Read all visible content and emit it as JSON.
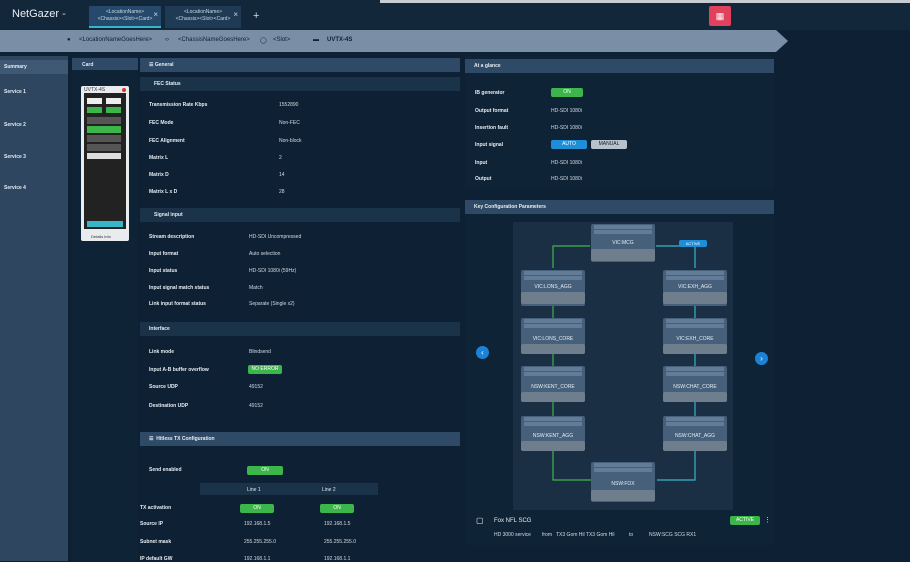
{
  "app": {
    "brand": "NetGazer",
    "brand_suffix": "-"
  },
  "tabs": [
    {
      "line1": "<LocationName>",
      "line2": "<Chassis><Slot><Card>"
    },
    {
      "line1": "<LocationName>",
      "line2": "<Chassis><Slot><Card>"
    }
  ],
  "breadcrumb": {
    "location": "<LocationNameGoesHere>",
    "chassis": "<ChassisNameGoesHere>",
    "slot": "<Slot>",
    "card": "UVTX-4S"
  },
  "sidebar": {
    "items": [
      {
        "label": "Summary"
      },
      {
        "label": "Service 1"
      },
      {
        "label": "Service 2"
      },
      {
        "label": "Service 3"
      },
      {
        "label": "Service 4"
      }
    ]
  },
  "card_panel": {
    "title": "Card",
    "device": {
      "name": "UVTX-4S",
      "footer": "Details info"
    }
  },
  "general": {
    "title": "General",
    "fec": {
      "title": "FEC Status",
      "rows": [
        {
          "k": "Transmission Rate Kbps",
          "v": "1552890"
        },
        {
          "k": "FEC Mode",
          "v": "Non-FEC"
        },
        {
          "k": "FEC Alignment",
          "v": "Non-block"
        },
        {
          "k": "Matrix L",
          "v": "2"
        },
        {
          "k": "Matrix D",
          "v": "14"
        },
        {
          "k": "Matrix L x D",
          "v": "28"
        }
      ]
    },
    "signal": {
      "title": "Signal input",
      "rows": [
        {
          "k": "Stream description",
          "v": "HD-SDI Uncompressed"
        },
        {
          "k": "Input format",
          "v": "Auto selection"
        },
        {
          "k": "Input status",
          "v": "HD-SDI 1080i (59Hz)"
        },
        {
          "k": "Input signal match status",
          "v": "Match"
        },
        {
          "k": "Link input format status",
          "v": "Separate (Single x2)"
        }
      ]
    },
    "interface": {
      "title": "Interface",
      "rows": [
        {
          "k": "Link mode",
          "v": "Blindsend"
        },
        {
          "k": "Input A-B buffer overflow",
          "v": "NO ERROR"
        },
        {
          "k": "Source UDP",
          "v": "49152"
        },
        {
          "k": "Destination UDP",
          "v": "49152"
        }
      ]
    }
  },
  "hitless": {
    "title": "Hitless TX Configuration",
    "send_enabled_label": "Send enabled",
    "send_enabled_value": "ON",
    "col1": "Line 1",
    "col2": "Line 2",
    "rows": [
      {
        "k": "TX activation",
        "v1": "ON",
        "v2": "ON"
      },
      {
        "k": "Source IP",
        "v1": "192.168.1.5",
        "v2": "192.168.1.5"
      },
      {
        "k": "Subnet mask",
        "v1": "255.255.255.0",
        "v2": "255.255.255.0"
      },
      {
        "k": "IP default GW",
        "v1": "192.168.1.1",
        "v2": "192.168.1.1"
      }
    ]
  },
  "glance": {
    "title": "At a glance",
    "rows": [
      {
        "k": "IB generator",
        "v": "ON"
      },
      {
        "k": "Output format",
        "v": "HD-SDI 1080i"
      },
      {
        "k": "Insertion fault",
        "v": "HD-SDI 1080i"
      },
      {
        "k": "Input signal",
        "auto": "AUTO",
        "manual": "MANUAL"
      },
      {
        "k": "Input",
        "v": "HD-SDI 1080i"
      },
      {
        "k": "Output",
        "v": "HD-SDI 1080i"
      }
    ]
  },
  "kcp": {
    "title": "Key Configuration Parameters",
    "nodes": [
      {
        "label": "VIC:MCG"
      },
      {
        "label": "VIC:LONS_AGG"
      },
      {
        "label": "VIC:EXH_AGG"
      },
      {
        "label": "VIC:LONS_CORE"
      },
      {
        "label": "VIC:EXH_CORE"
      },
      {
        "label": "NSW:KENT_CORE"
      },
      {
        "label": "NSW:CHAT_CORE"
      },
      {
        "label": "NSW:KENT_AGG"
      },
      {
        "label": "NSW:CHAT_AGG"
      },
      {
        "label": "NSW:FOX"
      }
    ],
    "active_badge": "ACTIVE"
  },
  "service": {
    "title": "Fox NFL SCG",
    "status": "ACTIVE",
    "detail": "HD 3000 service",
    "from_label": "from",
    "from_value": "TX3 Gom Hil TX3 Gom Hil",
    "to_label": "to",
    "to_value": "NSW:SCG  SCG RX1"
  },
  "colors": {
    "accent": "#39b5c8",
    "green": "#3cb54a",
    "blue": "#1f8ed8",
    "alert": "#e0415d"
  }
}
